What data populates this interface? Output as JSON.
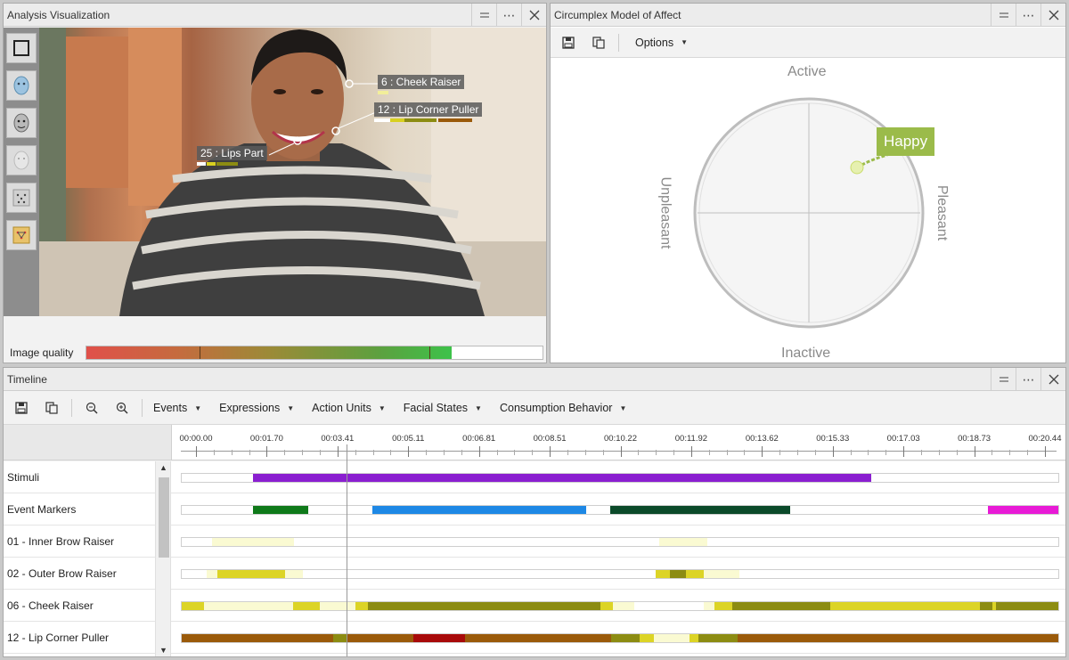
{
  "analysis": {
    "title": "Analysis Visualization",
    "image_quality_label": "Image quality",
    "image_quality_level": 0.8,
    "au_labels": [
      {
        "text": "6 : Cheek Raiser"
      },
      {
        "text": "12 : Lip Corner Puller"
      },
      {
        "text": "25 : Lips Part"
      }
    ]
  },
  "circumplex": {
    "title": "Circumplex Model of Affect",
    "options_label": "Options",
    "axis_top": "Active",
    "axis_bottom": "Inactive",
    "axis_left": "Unpleasant",
    "axis_right": "Pleasant",
    "emotion_label": "Happy"
  },
  "timeline": {
    "title": "Timeline",
    "menus": [
      "Events",
      "Expressions",
      "Action Units",
      "Facial States",
      "Consumption Behavior"
    ],
    "timestamps": [
      "00:00.00",
      "00:01.70",
      "00:03.41",
      "00:05.11",
      "00:06.81",
      "00:08.51",
      "00:10.22",
      "00:11.92",
      "00:13.62",
      "00:15.33",
      "00:17.03",
      "00:18.73",
      "00:20.44"
    ],
    "rows": [
      {
        "label": "Stimuli"
      },
      {
        "label": "Event Markers"
      },
      {
        "label": "01 - Inner Brow Raiser"
      },
      {
        "label": "02 - Outer Brow Raiser"
      },
      {
        "label": "06 - Cheek Raiser"
      },
      {
        "label": "12 - Lip Corner Puller"
      }
    ]
  },
  "colors": {
    "stimuli": "#8a1fd0",
    "marker_green": "#0f7a1a",
    "marker_blue": "#1e88e5",
    "marker_darkgreen": "#0b4a2a",
    "marker_magenta": "#e81ad6",
    "happy": "#9bbb4a"
  },
  "icons": [
    "square-icon",
    "face-mask-icon",
    "face-icon",
    "face-dim-icon",
    "face-points-icon",
    "face-mesh-icon",
    "save-icon",
    "copy-icon",
    "zoom-out-icon",
    "zoom-in-icon"
  ]
}
